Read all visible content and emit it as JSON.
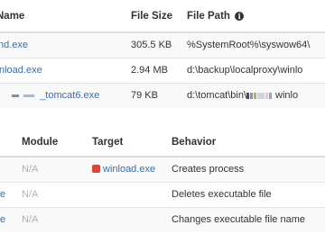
{
  "files_table": {
    "headers": {
      "name": "Name",
      "size": "File Size",
      "path": "File Path"
    },
    "rows": [
      {
        "name": "nd.exe",
        "size": "305.5 KB",
        "path": "%SystemRoot%\\syswow64\\"
      },
      {
        "name": "nload.exe",
        "size": "2.94 MB",
        "path": "d:\\backup\\localproxy\\winlo"
      },
      {
        "name": "_tomcat6.exe",
        "size": "79 KB",
        "path": "d:\\tomcat\\bin\\"
      }
    ],
    "path_tail_row3": "winlo"
  },
  "behavior_table": {
    "headers": {
      "module": "Module",
      "target": "Target",
      "behavior": "Behavior"
    },
    "rows": [
      {
        "actor": "",
        "module": "N/A",
        "target": "winload.exe",
        "behavior": "Creates process"
      },
      {
        "actor": "e",
        "module": "N/A",
        "target": "",
        "behavior": "Deletes executable file"
      },
      {
        "actor": "e",
        "module": "N/A",
        "target": "",
        "behavior": "Changes executable file name"
      }
    ]
  },
  "colors": {
    "link": "#3a6ea5",
    "target_badge": "#d9463c",
    "muted": "#b0b0b0"
  },
  "icons": {
    "path_info": "info-icon",
    "target_marker": "red-square-icon"
  }
}
